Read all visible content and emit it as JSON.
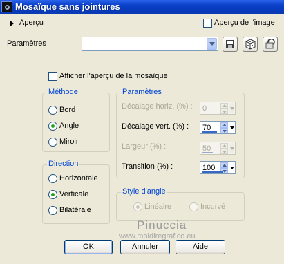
{
  "window": {
    "title": "Mosaïque sans jointures"
  },
  "preview": {
    "label": "Aperçu",
    "image_preview_label": "Aperçu de l'image"
  },
  "params": {
    "label": "Paramètres",
    "preset_value": ""
  },
  "show_preview": {
    "label": "Afficher l'aperçu de la mosaïque"
  },
  "method": {
    "title": "Méthode",
    "options": [
      "Bord",
      "Angle",
      "Miroir"
    ],
    "selected": "Angle"
  },
  "direction": {
    "title": "Direction",
    "options": [
      "Horizontale",
      "Verticale",
      "Bilatérale"
    ],
    "selected": "Verticale"
  },
  "parameters": {
    "title": "Paramètres",
    "fields": [
      {
        "label": "Décalage horiz. (%) :",
        "value": "0",
        "enabled": false
      },
      {
        "label": "Décalage vert. (%) :",
        "value": "70",
        "enabled": true
      },
      {
        "label": "Largeur (%) :",
        "value": "50",
        "enabled": false
      },
      {
        "label": "Transition (%) :",
        "value": "100",
        "enabled": true
      }
    ]
  },
  "corner_style": {
    "title": "Style d'angle",
    "options": [
      "Linéaire",
      "Incurvé"
    ],
    "selected": "Linéaire",
    "enabled": false
  },
  "watermark": {
    "name": "Pinuccia",
    "url": "www.moidiregrafico.eu"
  },
  "buttons": {
    "ok": "OK",
    "cancel": "Annuler",
    "help": "Aide"
  },
  "colors": {
    "titlebar": "#0a3fc7",
    "dialog_bg": "#ECE9D8",
    "group_title": "#0046d5",
    "radio_dot": "#21a121"
  }
}
